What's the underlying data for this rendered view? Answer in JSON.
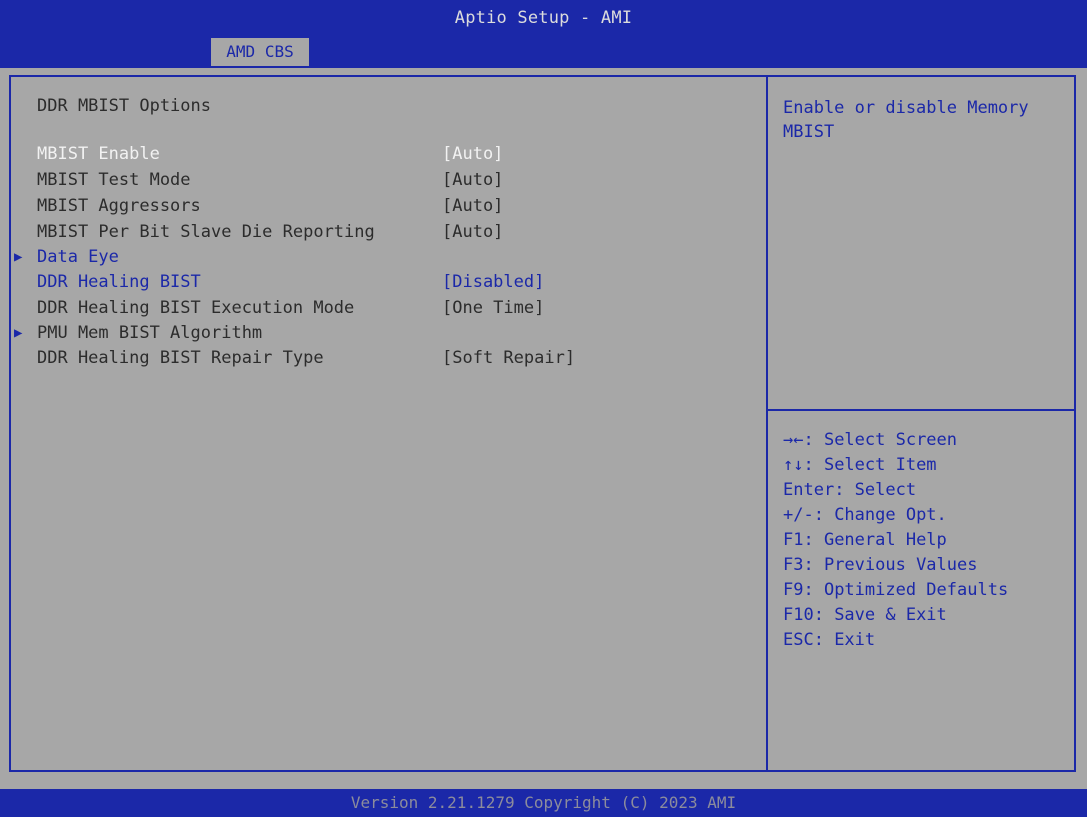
{
  "header": {
    "title": "Aptio Setup - AMI",
    "active_tab": "AMD CBS"
  },
  "main": {
    "section_title": "DDR MBIST Options",
    "items": [
      {
        "label": "MBIST Enable",
        "value": "[Auto]",
        "state": "selected"
      },
      {
        "label": "MBIST Test Mode",
        "value": "[Auto]",
        "state": "normal"
      },
      {
        "label": "MBIST Aggressors",
        "value": "[Auto]",
        "state": "normal"
      },
      {
        "label": "MBIST Per Bit Slave Die Reporting",
        "value": "[Auto]",
        "state": "normal"
      },
      {
        "label": "Data Eye",
        "value": "",
        "state": "submenu"
      },
      {
        "label": "DDR Healing BIST",
        "value": "[Disabled]",
        "state": "blue"
      },
      {
        "label": "DDR Healing BIST Execution Mode",
        "value": "[One Time]",
        "state": "normal"
      },
      {
        "label": "PMU Mem BIST Algorithm",
        "value": "",
        "state": "submenu"
      },
      {
        "label": "DDR Healing BIST Repair Type",
        "value": "[Soft Repair]",
        "state": "normal"
      }
    ]
  },
  "help": {
    "description": "Enable or disable Memory MBIST",
    "keys": [
      {
        "key": "→←",
        "desc": ": Select Screen"
      },
      {
        "key": "↑↓",
        "desc": ": Select Item"
      },
      {
        "key": "Enter",
        "desc": ": Select"
      },
      {
        "key": "+/-",
        "desc": ": Change Opt."
      },
      {
        "key": "F1",
        "desc": ": General Help"
      },
      {
        "key": "F3",
        "desc": ": Previous Values"
      },
      {
        "key": "F9",
        "desc": ": Optimized Defaults"
      },
      {
        "key": "F10",
        "desc": ": Save & Exit"
      },
      {
        "key": "ESC",
        "desc": ": Exit"
      }
    ]
  },
  "footer": {
    "text": "Version 2.21.1279 Copyright (C) 2023 AMI"
  },
  "colors": {
    "bios_blue": "#1b28a8",
    "background_gray": "#a7a7a7",
    "selected_text": "#f2f2f2"
  }
}
